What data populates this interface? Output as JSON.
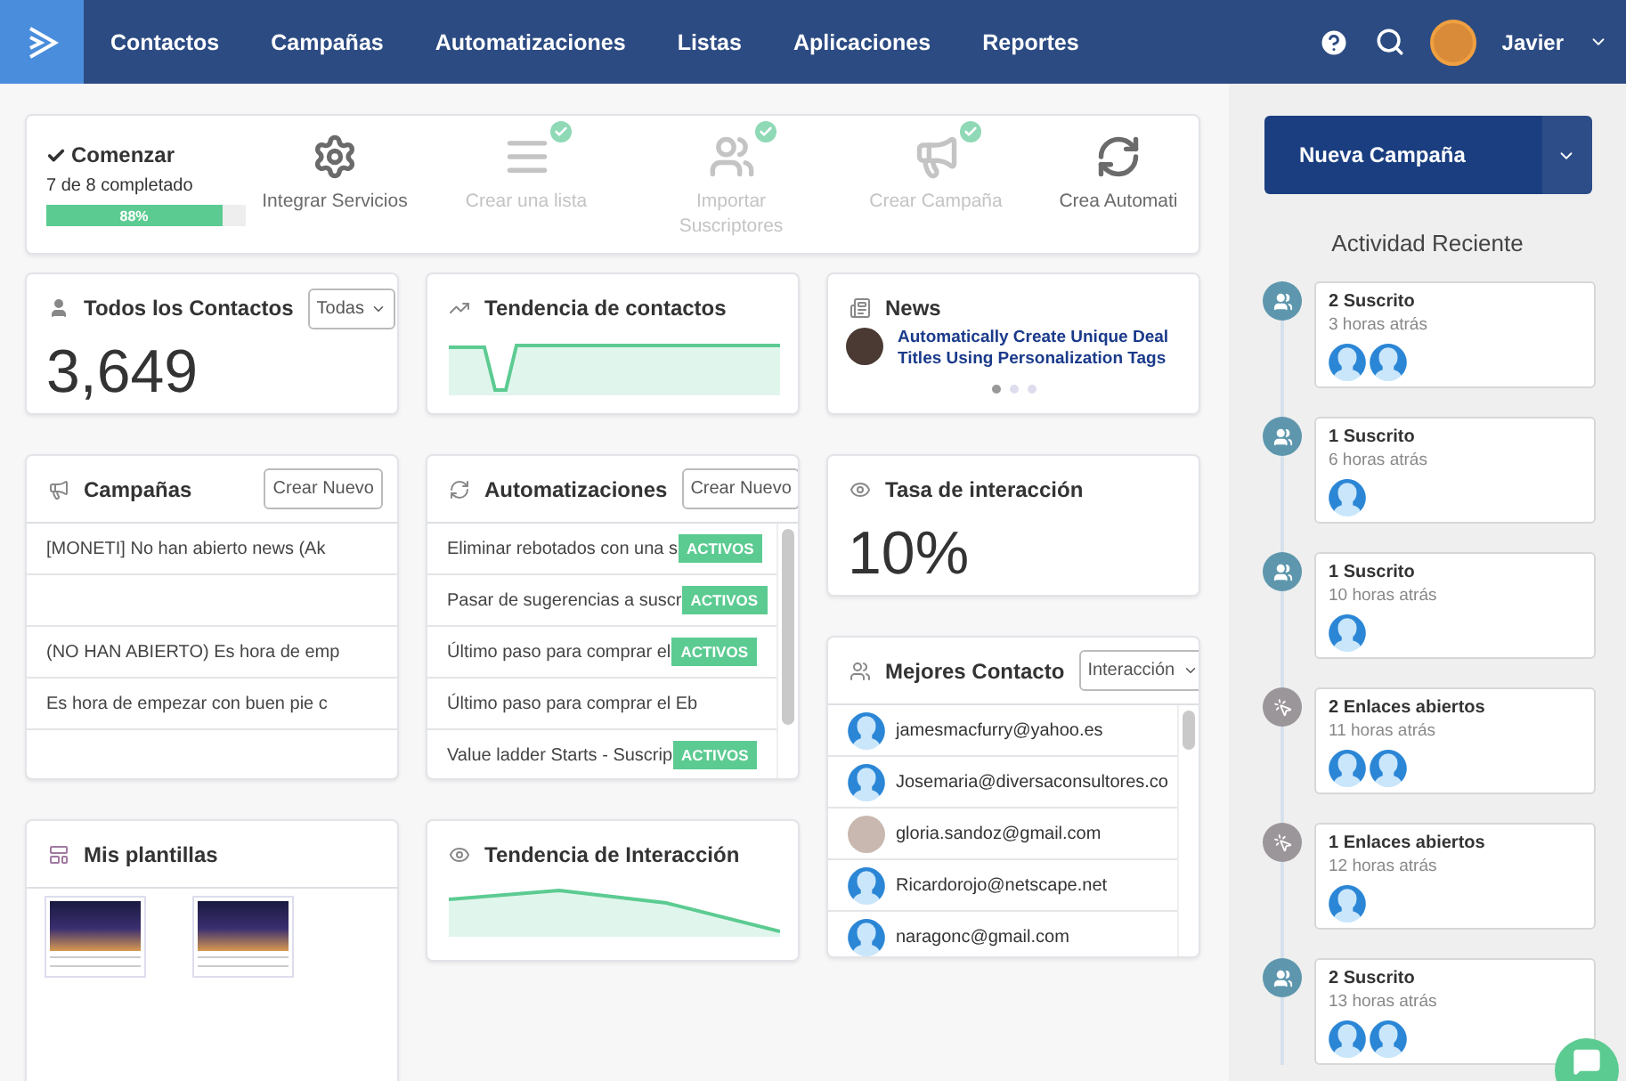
{
  "nav": {
    "items": [
      {
        "label": "Contactos",
        "selected": false
      },
      {
        "label": "Campañas",
        "selected": false
      },
      {
        "label": "Automatizaciones",
        "selected": false
      },
      {
        "label": "Listas",
        "selected": false
      },
      {
        "label": "Aplicaciones",
        "selected": false
      },
      {
        "label": "Reportes",
        "selected": false
      }
    ],
    "user": "Javier"
  },
  "onboarding": {
    "title": "Comenzar",
    "progress_text": "7 de 8 completado",
    "level": 0.88,
    "reading": "88%",
    "steps": [
      {
        "kind": "gear",
        "label": "Integrar Servicios",
        "done": false
      },
      {
        "kind": "list",
        "label": "Crear una lista",
        "done": true
      },
      {
        "kind": "users",
        "label": "Importar Suscriptores",
        "done": true
      },
      {
        "kind": "megaphone",
        "label": "Crear Campaña",
        "done": true
      },
      {
        "kind": "refresh",
        "label": "Crea Automati",
        "done": false
      }
    ]
  },
  "contacts": {
    "title": "Todos los Contactos",
    "filter": "Todas",
    "count": "3,649"
  },
  "contact_trend": {
    "title": "Tendencia de contactos"
  },
  "news": {
    "title": "News",
    "headline": "Automatically Create Unique Deal Titles Using Personalization Tags",
    "slides": [
      {
        "selected": true
      },
      {
        "selected": false
      },
      {
        "selected": false
      }
    ]
  },
  "campaigns": {
    "title": "Campañas",
    "button": "Crear Nuevo",
    "rows": [
      "[MONETI] No han abierto news (Ak",
      "",
      "(NO HAN ABIERTO) Es hora de emp",
      "Es hora de empezar con buen pie c"
    ]
  },
  "automations": {
    "title": "Automatizaciones",
    "button": "Crear Nuevo",
    "rows": [
      {
        "name": "Eliminar rebotados con una s",
        "active": true,
        "badge": "ACTIVOS"
      },
      {
        "name": "Pasar de sugerencias a suscr",
        "active": true,
        "badge": "ACTIVOS"
      },
      {
        "name": "Último paso para comprar el",
        "active": true,
        "badge": "ACTIVOS"
      },
      {
        "name": "Último paso para comprar el Eb",
        "active": false
      },
      {
        "name": "Value ladder Starts - Suscrip",
        "active": true,
        "badge": "ACTIVOS"
      }
    ]
  },
  "engagement_rate": {
    "title": "Tasa de interacción",
    "value": "10%"
  },
  "top_contacts": {
    "title": "Mejores Contacto",
    "filter": "Interacción",
    "rows": [
      {
        "email": "jamesmacfurry@yahoo.es",
        "kind": "default"
      },
      {
        "email": "Josemaria@diversaconsultores.co",
        "kind": "default"
      },
      {
        "email": "gloria.sandoz@gmail.com",
        "kind": "photo"
      },
      {
        "email": "Ricardorojo@netscape.net",
        "kind": "default"
      },
      {
        "email": "naragonc@gmail.com",
        "kind": "default"
      }
    ]
  },
  "templates": {
    "title": "Mis plantillas",
    "items": [
      {
        "kind": "image"
      },
      {
        "kind": "image"
      }
    ]
  },
  "engagement_trend": {
    "title": "Tendencia de Interacción"
  },
  "sidebar": {
    "button": "Nueva Campaña",
    "heading": "Actividad Reciente",
    "activity": [
      {
        "kind": "subscribed",
        "title": "2 Suscrito",
        "time": "3 horas atrás",
        "avatars": [
          {
            "kind": "default"
          },
          {
            "kind": "default"
          }
        ]
      },
      {
        "kind": "subscribed",
        "title": "1 Suscrito",
        "time": "6 horas atrás",
        "avatars": [
          {
            "kind": "default"
          }
        ]
      },
      {
        "kind": "subscribed",
        "title": "1 Suscrito",
        "time": "10 horas atrás",
        "avatars": [
          {
            "kind": "default"
          }
        ]
      },
      {
        "kind": "link",
        "title": "2 Enlaces abiertos",
        "time": "11 horas atrás",
        "avatars": [
          {
            "kind": "default"
          },
          {
            "kind": "default"
          }
        ]
      },
      {
        "kind": "link",
        "title": "1 Enlaces abiertos",
        "time": "12 horas atrás",
        "avatars": [
          {
            "kind": "default"
          }
        ]
      },
      {
        "kind": "subscribed",
        "title": "2 Suscrito",
        "time": "13 horas atrás",
        "avatars": [
          {
            "kind": "default"
          },
          {
            "kind": "default"
          }
        ]
      }
    ]
  }
}
